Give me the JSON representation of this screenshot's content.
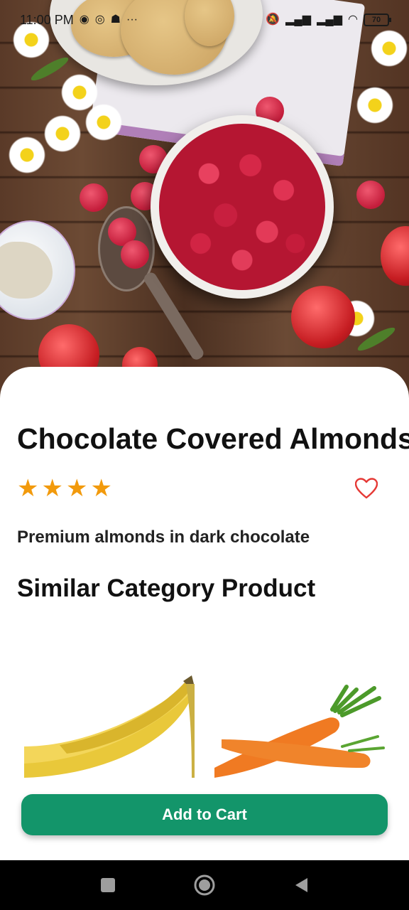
{
  "status_bar": {
    "time": "11:00 PM",
    "battery": "70"
  },
  "product": {
    "title": "Chocolate Covered Almonds",
    "rating": 4,
    "description": "Premium almonds in dark chocolate"
  },
  "section": {
    "similar_title": "Similar Category Product"
  },
  "similar_products": [
    {
      "icon": "banana-image"
    },
    {
      "icon": "carrot-image"
    }
  ],
  "cta": {
    "label": "Add to Cart",
    "color": "#13956a"
  },
  "colors": {
    "star": "#f29a0c",
    "heart": "#e53935"
  }
}
